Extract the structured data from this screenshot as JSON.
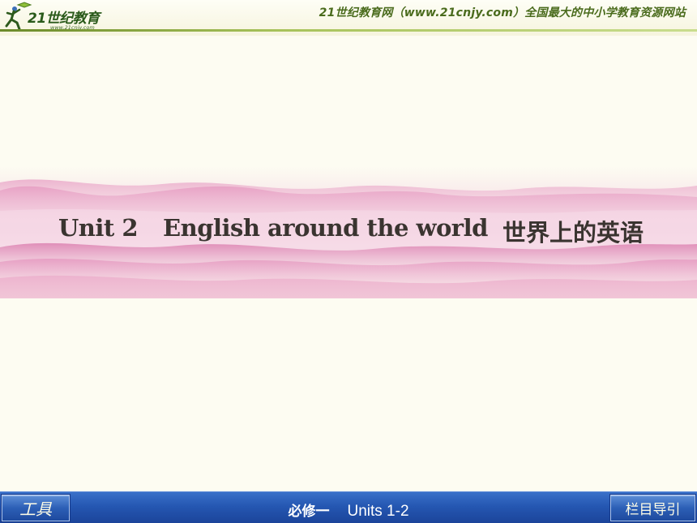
{
  "header": {
    "logo_text": "21世纪教育",
    "logo_subtext": "www.21cnjy.com",
    "slogan": "21世纪教育网（www.21cnjy.com）全国最大的中小学教育资源网站"
  },
  "banner": {
    "unit_label": "Unit 2",
    "topic_en": "English around the world",
    "topic_cn": "世界上的英语"
  },
  "footer": {
    "tools_button": "工具",
    "course_label": "必修一",
    "units_label": "Units  1-2",
    "nav_button": "栏目导引"
  },
  "colors": {
    "page_background": "#fdfcf2",
    "header_accent": "#6b8a2a",
    "banner_pink": "#e7a6c6",
    "footer_blue": "#2557b2",
    "title_text": "#3a3430"
  },
  "icons": {
    "logo": "running-figure-with-book-logo-icon"
  }
}
